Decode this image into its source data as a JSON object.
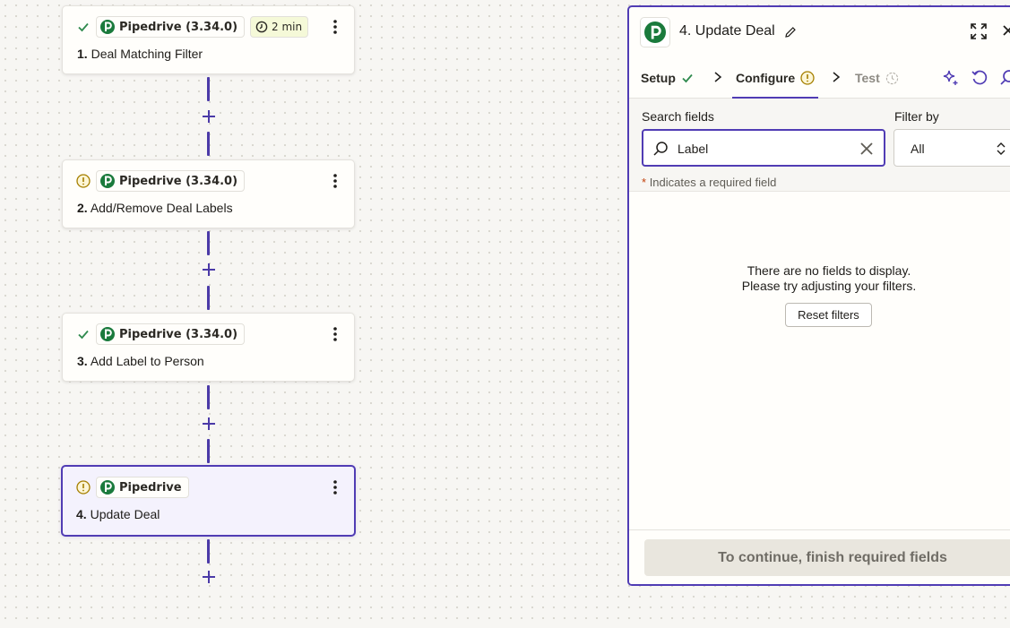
{
  "colors": {
    "accent": "#503cb4",
    "success": "#2f8a4e",
    "warning": "#a57f00",
    "pipedrive_brand": "#1a7a3c"
  },
  "steps": [
    {
      "number": "1.",
      "title": "Deal Matching Filter",
      "app": "Pipedrive (3.34.0)",
      "status": "check-icon",
      "timer": "2 min"
    },
    {
      "number": "2.",
      "title": "Add/Remove Deal Labels",
      "app": "Pipedrive (3.34.0)",
      "status": "warning-icon"
    },
    {
      "number": "3.",
      "title": "Add Label to Person",
      "app": "Pipedrive (3.34.0)",
      "status": "check-icon"
    },
    {
      "number": "4.",
      "title": "Update Deal",
      "app": "Pipedrive",
      "status": "warning-icon",
      "selected": true
    }
  ],
  "panel": {
    "title": "4. Update Deal",
    "app_logo_letter": "P",
    "tabs": [
      {
        "label": "Setup",
        "status": "check-icon"
      },
      {
        "label": "Configure",
        "status": "warning-icon",
        "active": true
      },
      {
        "label": "Test",
        "status": "timer-icon"
      }
    ],
    "search": {
      "label": "Search fields",
      "value": "Label"
    },
    "filter": {
      "label": "Filter by",
      "selected": "All"
    },
    "required_note_star": "*",
    "required_note": "Indicates a required field",
    "empty_line1": "There are no fields to display.",
    "empty_line2": "Please try adjusting your filters.",
    "reset_button": "Reset filters",
    "continue_button": "To continue, finish required fields"
  }
}
